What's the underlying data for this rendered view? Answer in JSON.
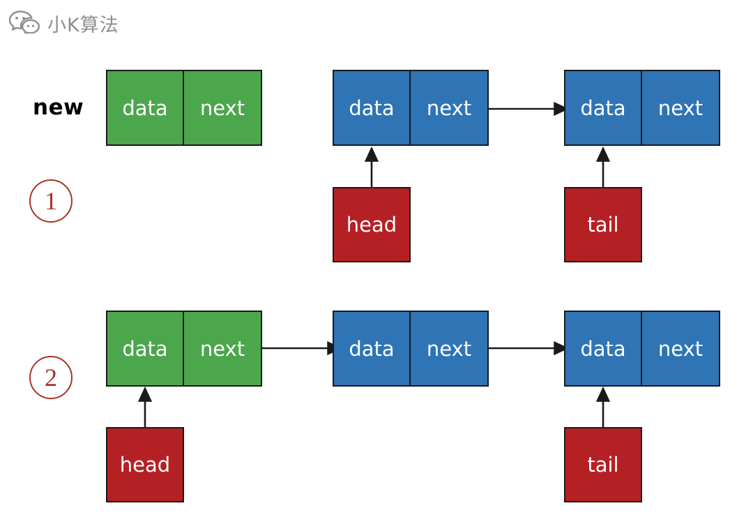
{
  "watermark": {
    "icon": "wechat-bubbles-icon",
    "text": "小K算法",
    "color": "#8e8e8e"
  },
  "colors": {
    "new_node": "#4ca64c",
    "list_node": "#2f74b5",
    "pointer_box": "#b52025",
    "marker": "#a93226",
    "stroke": "#1a1a1a",
    "label": "#000000",
    "background": "#ffffff"
  },
  "labels": {
    "new": "new"
  },
  "steps": [
    {
      "marker": "1",
      "nodes": [
        {
          "id": "new-node",
          "color": "green",
          "data_label": "data",
          "next_label": "next"
        },
        {
          "id": "node-head",
          "color": "blue",
          "data_label": "data",
          "next_label": "next"
        },
        {
          "id": "node-tail",
          "color": "blue",
          "data_label": "data",
          "next_label": "next"
        }
      ],
      "pointers": [
        {
          "id": "head-pointer",
          "label": "head"
        },
        {
          "id": "tail-pointer",
          "label": "tail"
        }
      ]
    },
    {
      "marker": "2",
      "nodes": [
        {
          "id": "new-node-linked",
          "color": "green",
          "data_label": "data",
          "next_label": "next"
        },
        {
          "id": "node-middle",
          "color": "blue",
          "data_label": "data",
          "next_label": "next"
        },
        {
          "id": "node-tail-2",
          "color": "blue",
          "data_label": "data",
          "next_label": "next"
        }
      ],
      "pointers": [
        {
          "id": "head-pointer-2",
          "label": "head"
        },
        {
          "id": "tail-pointer-2",
          "label": "tail"
        }
      ]
    }
  ]
}
